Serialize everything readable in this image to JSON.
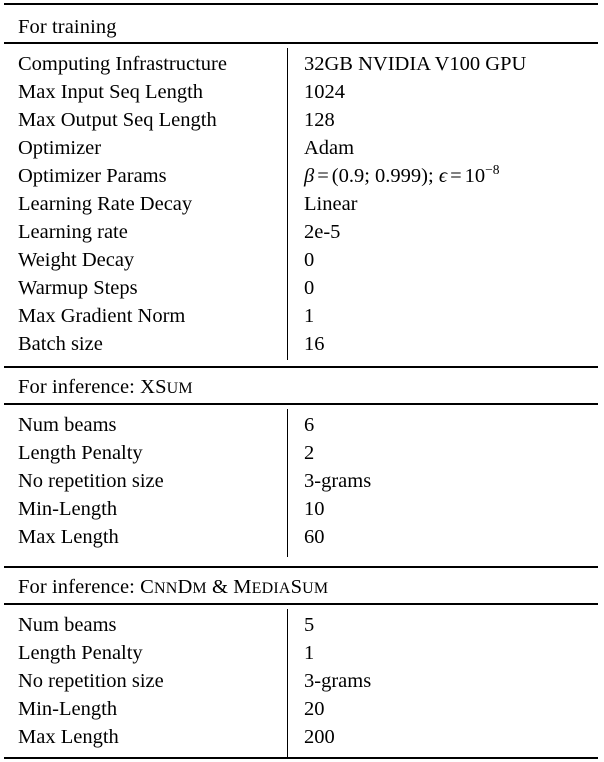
{
  "table": {
    "sections": [
      {
        "title": "For training",
        "title_parts": [
          {
            "text": "For training",
            "smallcaps": false
          }
        ],
        "rows": [
          {
            "label": "Computing Infrastructure",
            "value": "32GB NVIDIA V100 GPU"
          },
          {
            "label": "Max Input Seq Length",
            "value": "1024"
          },
          {
            "label": "Max Output Seq Length",
            "value": "128"
          },
          {
            "label": "Optimizer",
            "value": "Adam"
          },
          {
            "label": "Optimizer Params",
            "value": "β = (0.9; 0.999); ϵ = 10⁻⁸",
            "math": true
          },
          {
            "label": "Learning Rate Decay",
            "value": "Linear"
          },
          {
            "label": "Learning rate",
            "value": "2e-5"
          },
          {
            "label": "Weight Decay",
            "value": "0"
          },
          {
            "label": "Warmup Steps",
            "value": "0"
          },
          {
            "label": "Max Gradient Norm",
            "value": "1"
          },
          {
            "label": "Batch size",
            "value": "16"
          }
        ]
      },
      {
        "title": "For inference: XSum",
        "title_parts": [
          {
            "text": "For inference: XS",
            "smallcaps": false
          },
          {
            "text": "UM",
            "smallcaps": true
          }
        ],
        "rows": [
          {
            "label": "Num beams",
            "value": "6"
          },
          {
            "label": "Length Penalty",
            "value": "2"
          },
          {
            "label": "No repetition size",
            "value": "3-grams"
          },
          {
            "label": "Min-Length",
            "value": "10"
          },
          {
            "label": "Max Length",
            "value": "60"
          }
        ]
      },
      {
        "title": "For inference: CnnDm & MediaSum",
        "title_parts": [
          {
            "text": "For inference: C",
            "smallcaps": false
          },
          {
            "text": "NN",
            "smallcaps": true
          },
          {
            "text": "D",
            "smallcaps": false
          },
          {
            "text": "M",
            "smallcaps": true
          },
          {
            "text": " & M",
            "smallcaps": false
          },
          {
            "text": "EDIA",
            "smallcaps": true
          },
          {
            "text": "S",
            "smallcaps": false
          },
          {
            "text": "UM",
            "smallcaps": true
          }
        ],
        "rows": [
          {
            "label": "Num beams",
            "value": "5"
          },
          {
            "label": "Length Penalty",
            "value": "1"
          },
          {
            "label": "No repetition size",
            "value": "3-grams"
          },
          {
            "label": "Min-Length",
            "value": "20"
          },
          {
            "label": "Max Length",
            "value": "200"
          }
        ]
      }
    ],
    "math_expression": {
      "beta_symbol": "β",
      "equals": "=",
      "beta_values": "(0.9; 0.999);",
      "epsilon_symbol": "ϵ",
      "epsilon_base": "10",
      "epsilon_exponent": "−8"
    },
    "colors": {
      "text": "#000000",
      "rule": "#000000",
      "background": "#ffffff"
    }
  }
}
